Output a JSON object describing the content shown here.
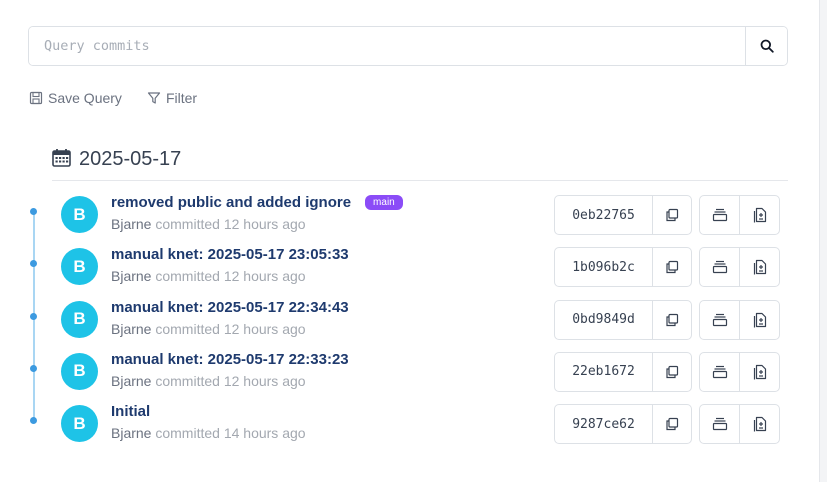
{
  "search": {
    "placeholder": "Query commits",
    "value": ""
  },
  "toolbar": {
    "save_query_label": "Save Query",
    "filter_label": "Filter"
  },
  "date_group": {
    "date": "2025-05-17"
  },
  "commits": [
    {
      "message": "removed public and added ignore",
      "badge": "main",
      "avatar_initial": "B",
      "author": "Bjarne",
      "committed_text": "committed 12 hours ago",
      "hash": "0eb22765"
    },
    {
      "message": "manual knet: 2025-05-17 23:05:33",
      "badge": "",
      "avatar_initial": "B",
      "author": "Bjarne",
      "committed_text": "committed 12 hours ago",
      "hash": "1b096b2c"
    },
    {
      "message": "manual knet: 2025-05-17 22:34:43",
      "badge": "",
      "avatar_initial": "B",
      "author": "Bjarne",
      "committed_text": "committed 12 hours ago",
      "hash": "0bd9849d"
    },
    {
      "message": "manual knet: 2025-05-17 22:33:23",
      "badge": "",
      "avatar_initial": "B",
      "author": "Bjarne",
      "committed_text": "committed 12 hours ago",
      "hash": "22eb1672"
    },
    {
      "message": "Initial",
      "badge": "",
      "avatar_initial": "B",
      "author": "Bjarne",
      "committed_text": "committed 14 hours ago",
      "hash": "9287ce62"
    }
  ],
  "colors": {
    "avatar": "#1ec3e7",
    "badge": "#8b4cf7",
    "timeline": "#3c9ae0",
    "message": "#1e3a6e"
  },
  "icons": {
    "search": "search-icon",
    "save": "save-icon",
    "filter": "filter-icon",
    "calendar": "calendar-icon",
    "copy": "copy-icon",
    "browse": "browse-files-icon",
    "diff": "diff-file-icon"
  }
}
